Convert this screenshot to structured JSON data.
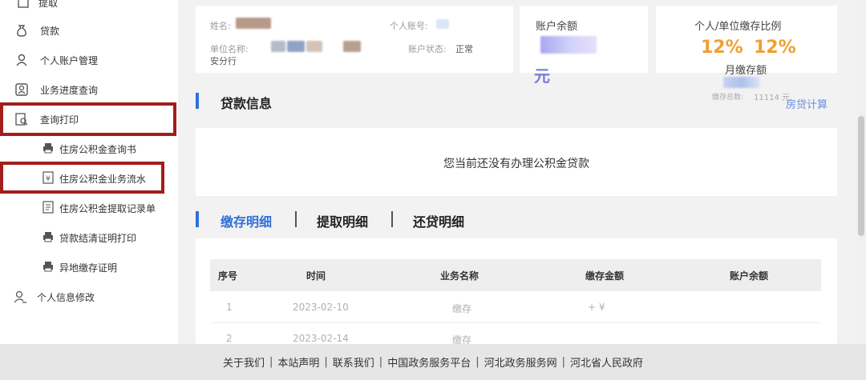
{
  "sidebar": {
    "withdraw": "提取",
    "loan": "贷款",
    "personal_account": "个人账户管理",
    "progress": "业务进度查询",
    "query_print": "查询打印",
    "sub_items": [
      "住房公积金查询书",
      "住房公积金业务流水",
      "住房公积金提取记录单",
      "贷款结清证明打印",
      "异地缴存证明"
    ],
    "personal_info": "个人信息修改"
  },
  "account": {
    "name_label": "姓名:",
    "account_no_label": "个人账号:",
    "unit_label": "单位名称:",
    "unit_suffix": "安分行",
    "status_label": "账户状态:",
    "status_value": "正常"
  },
  "balance": {
    "title": "账户余额",
    "unit": "元"
  },
  "ratio": {
    "title": "个人/单位缴存比例",
    "personal": "12%",
    "unit": "12%",
    "monthly_label": "月缴存额",
    "total_label": "缴存总数:",
    "total_value": "11114 元"
  },
  "loan_section": {
    "title": "贷款信息",
    "calc_link": "房贷计算",
    "empty_message": "您当前还没有办理公积金贷款"
  },
  "tabs": [
    {
      "label": "缴存明细",
      "active": true
    },
    {
      "label": "提取明细",
      "active": false
    },
    {
      "label": "还贷明细",
      "active": false
    }
  ],
  "table": {
    "headers": [
      "序号",
      "时间",
      "业务名称",
      "缴存金额",
      "账户余额"
    ],
    "rows": [
      [
        "1",
        "2023-02-10",
        "缴存",
        "+ ¥",
        ""
      ],
      [
        "2",
        "2023-02-14",
        "缴存",
        "",
        ""
      ]
    ]
  },
  "footer": {
    "links": [
      "关于我们",
      "本站声明",
      "联系我们",
      "中国政务服务平台",
      "河北政务服务网",
      "河北省人民政府"
    ]
  },
  "colors": {
    "accent_blue": "#2f6fd6",
    "orange": "#f0a030",
    "highlight_red": "#a31d1d"
  }
}
